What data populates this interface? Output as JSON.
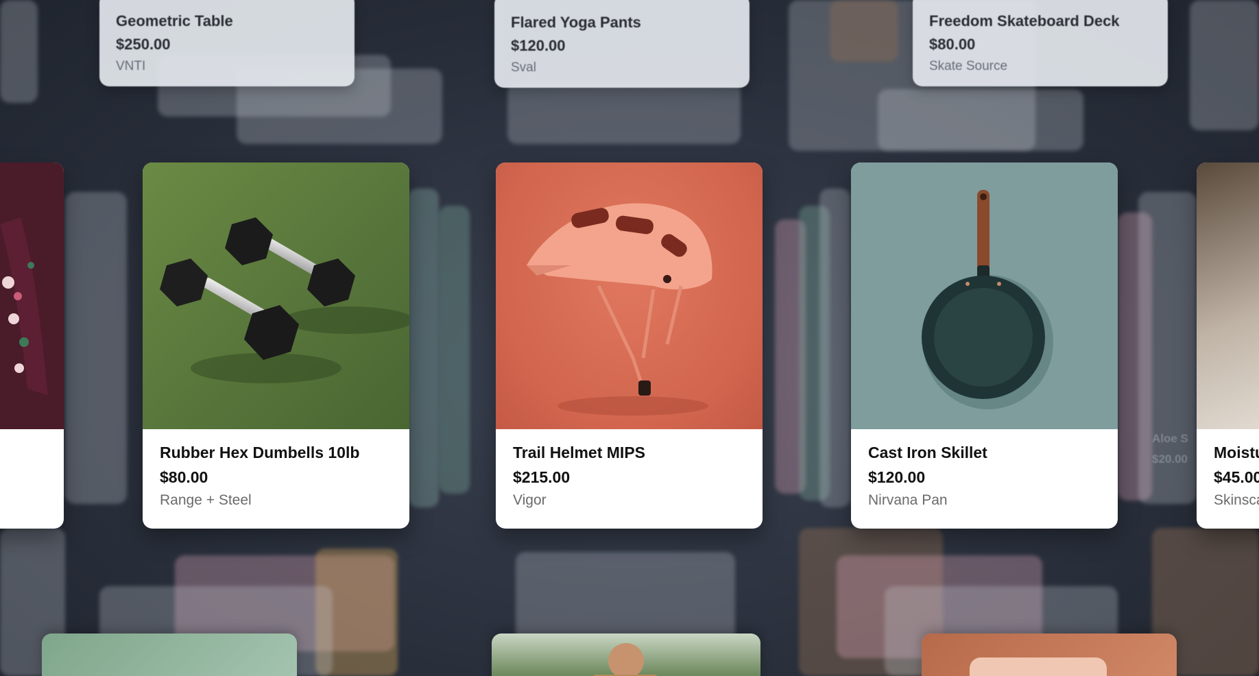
{
  "top_row": [
    {
      "name": "Geometric Table",
      "price": "$250.00",
      "brand": "VNTI"
    },
    {
      "name": "Flared Yoga Pants",
      "price": "$120.00",
      "brand": "Sval"
    },
    {
      "name": "Freedom Skateboard Deck",
      "price": "$80.00",
      "brand": "Skate Source"
    }
  ],
  "products": [
    {
      "name": "Rubber Hex Dumbells 10lb",
      "price": "$80.00",
      "brand": "Range + Steel",
      "image_icon": "dumbbells-image",
      "image_bg": "#5e7a3a"
    },
    {
      "name": "Trail Helmet MIPS",
      "price": "$215.00",
      "brand": "Vigor",
      "image_icon": "helmet-image",
      "image_bg": "#d86f58"
    },
    {
      "name": "Cast Iron Skillet",
      "price": "$120.00",
      "brand": "Nirvana Pan",
      "image_icon": "skillet-image",
      "image_bg": "#7e9d9d"
    }
  ],
  "partial_right": {
    "name": "Moistu",
    "price": "$45.00",
    "brand": "Skinsca"
  },
  "ghost_labels": {
    "aloe": "Aloe S",
    "aloe_price": "$20.00"
  },
  "colors": {
    "background": "#2a303c",
    "card": "#ffffff",
    "text_primary": "#111111",
    "text_secondary": "#6a6a6a"
  }
}
